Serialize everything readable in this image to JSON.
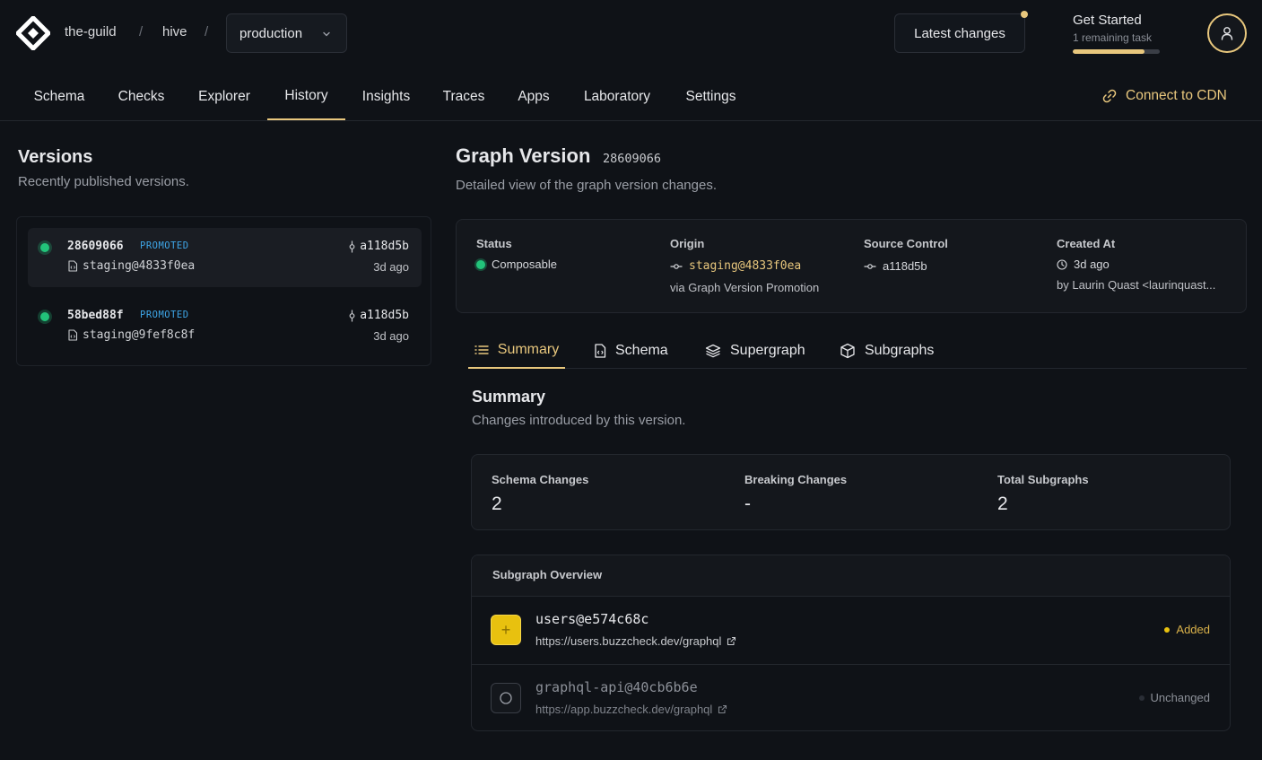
{
  "header": {
    "org": "the-guild",
    "project": "hive",
    "separator": "/",
    "target": "production",
    "latest_changes": "Latest changes",
    "get_started": {
      "title": "Get Started",
      "subtitle": "1 remaining task",
      "progress": 0.82
    }
  },
  "nav": {
    "tabs": [
      "Schema",
      "Checks",
      "Explorer",
      "History",
      "Insights",
      "Traces",
      "Apps",
      "Laboratory",
      "Settings"
    ],
    "active": "History",
    "cdn_link": "Connect to CDN"
  },
  "versions": {
    "title": "Versions",
    "subtitle": "Recently published versions.",
    "items": [
      {
        "id": "28609066",
        "badge": "PROMOTED",
        "commit": "a118d5b",
        "origin": "staging@4833f0ea",
        "ago": "3d ago"
      },
      {
        "id": "58bed88f",
        "badge": "PROMOTED",
        "commit": "a118d5b",
        "origin": "staging@9fef8c8f",
        "ago": "3d ago"
      }
    ]
  },
  "graph_version": {
    "title": "Graph Version",
    "id": "28609066",
    "subtitle": "Detailed view of the graph version changes.",
    "meta": {
      "status_label": "Status",
      "status_value": "Composable",
      "origin_label": "Origin",
      "origin_value": "staging@4833f0ea",
      "origin_note": "via Graph Version Promotion",
      "source_label": "Source Control",
      "source_value": "a118d5b",
      "created_label": "Created At",
      "created_value": "3d ago",
      "created_by": "by Laurin Quast <laurinquast..."
    }
  },
  "subtabs": [
    "Summary",
    "Schema",
    "Supergraph",
    "Subgraphs"
  ],
  "summary": {
    "title": "Summary",
    "subtitle": "Changes introduced by this version.",
    "stats": [
      {
        "label": "Schema Changes",
        "value": "2"
      },
      {
        "label": "Breaking Changes",
        "value": "-"
      },
      {
        "label": "Total Subgraphs",
        "value": "2"
      }
    ]
  },
  "overview": {
    "title": "Subgraph Overview",
    "rows": [
      {
        "name": "users@e574c68c",
        "url": "https://users.buzzcheck.dev/graphql",
        "status": "Added",
        "icon": "+"
      },
      {
        "name": "graphql-api@40cb6b6e",
        "url": "https://app.buzzcheck.dev/graphql",
        "status": "Unchanged",
        "icon": ""
      }
    ]
  },
  "colors": {
    "accent": "#e8c77d",
    "success": "#22c37a",
    "badge": "#3ea6e8",
    "added": "#e8c10f"
  }
}
